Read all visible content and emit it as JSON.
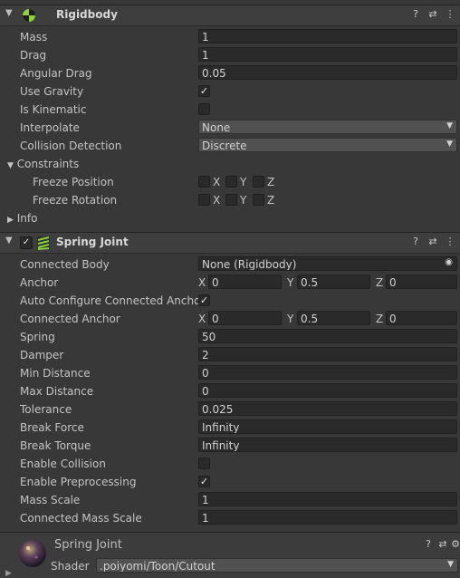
{
  "rigidbody": {
    "title": "Rigidbody",
    "mass_label": "Mass",
    "mass": "1",
    "drag_label": "Drag",
    "drag": "1",
    "angular_drag_label": "Angular Drag",
    "angular_drag": "0.05",
    "use_gravity_label": "Use Gravity",
    "use_gravity": true,
    "is_kinematic_label": "Is Kinematic",
    "is_kinematic": false,
    "interpolate_label": "Interpolate",
    "interpolate": "None",
    "collision_detection_label": "Collision Detection",
    "collision_detection": "Discrete",
    "constraints_label": "Constraints",
    "freeze_position_label": "Freeze Position",
    "freeze_rotation_label": "Freeze Rotation",
    "info_label": "Info"
  },
  "axes": {
    "x": "X",
    "y": "Y",
    "z": "Z"
  },
  "spring_joint": {
    "title": "Spring Joint",
    "connected_body_label": "Connected Body",
    "connected_body": "None (Rigidbody)",
    "anchor_label": "Anchor",
    "anchor": {
      "x": "0",
      "y": "0.5",
      "z": "0"
    },
    "auto_configure_label": "Auto Configure Connected Anchor",
    "auto_configure": true,
    "connected_anchor_label": "Connected Anchor",
    "connected_anchor": {
      "x": "0",
      "y": "0.5",
      "z": "0"
    },
    "spring_label": "Spring",
    "spring": "50",
    "damper_label": "Damper",
    "damper": "2",
    "min_distance_label": "Min Distance",
    "min_distance": "0",
    "max_distance_label": "Max Distance",
    "max_distance": "0",
    "tolerance_label": "Tolerance",
    "tolerance": "0.025",
    "break_force_label": "Break Force",
    "break_force": "Infinity",
    "break_torque_label": "Break Torque",
    "break_torque": "Infinity",
    "enable_collision_label": "Enable Collision",
    "enable_collision": false,
    "enable_preprocessing_label": "Enable Preprocessing",
    "enable_preprocessing": true,
    "mass_scale_label": "Mass Scale",
    "mass_scale": "1",
    "connected_mass_scale_label": "Connected Mass Scale",
    "connected_mass_scale": "1"
  },
  "material": {
    "title": "Spring Joint",
    "shader_label": "Shader",
    "shader": ".poiyomi/Toon/Cutout"
  },
  "icons": {
    "help": "help-icon",
    "presets": "presets-icon",
    "menu": "kebab-menu-icon",
    "check": "✓",
    "fold_open": "▼",
    "fold_closed": "▶",
    "dropdown": "▼"
  },
  "colors": {
    "background": "#383838",
    "field": "#2a2a2a",
    "header": "#3e3e3e"
  }
}
